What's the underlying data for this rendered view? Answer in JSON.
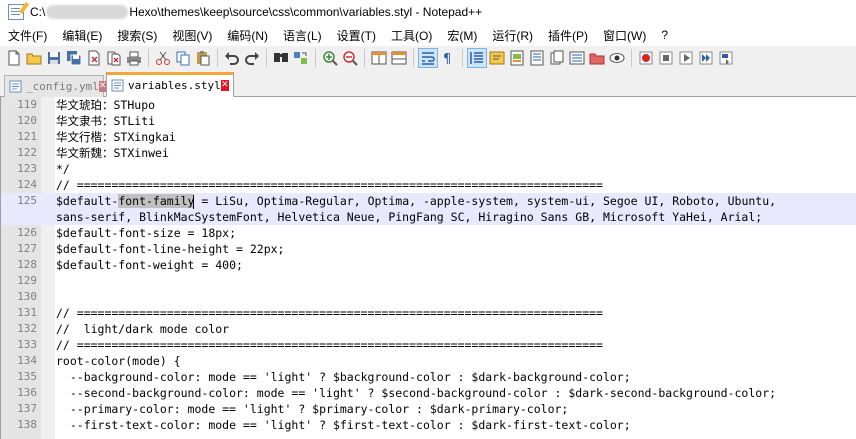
{
  "window": {
    "title_prefix": "C:\\",
    "title_suffix": "Hexo\\themes\\keep\\source\\css\\common\\variables.styl - Notepad++"
  },
  "menu": [
    "文件(F)",
    "编辑(E)",
    "搜索(S)",
    "视图(V)",
    "编码(N)",
    "语言(L)",
    "设置(T)",
    "工具(O)",
    "宏(M)",
    "运行(R)",
    "插件(P)",
    "窗口(W)",
    "?"
  ],
  "tabs": [
    {
      "label": "_config.yml",
      "active": false
    },
    {
      "label": "variables.styl",
      "active": true
    }
  ],
  "editor": {
    "lines": [
      {
        "num": "119",
        "text": "华文琥珀：STHupo"
      },
      {
        "num": "120",
        "text": "华文隶书：STLiti"
      },
      {
        "num": "121",
        "text": "华文行楷：STXingkai"
      },
      {
        "num": "122",
        "text": "华文新魏：STXinwei"
      },
      {
        "num": "123",
        "text": "*/"
      },
      {
        "num": "124",
        "text": "// ============================================================================"
      },
      {
        "num": "125",
        "pre": "$default-",
        "sel": "font-family",
        "post": " = LiSu, Optima-Regular, Optima, -apple-system, system-ui, Segoe UI, Roboto, Ubuntu,"
      },
      {
        "num": "",
        "text": "sans-serif, BlinkMacSystemFont, Helvetica Neue, PingFang SC, Hiragino Sans GB, Microsoft YaHei, Arial;"
      },
      {
        "num": "126",
        "text": "$default-font-size = 18px;"
      },
      {
        "num": "127",
        "text": "$default-font-line-height = 22px;"
      },
      {
        "num": "128",
        "text": "$default-font-weight = 400;"
      },
      {
        "num": "129",
        "text": ""
      },
      {
        "num": "130",
        "text": ""
      },
      {
        "num": "131",
        "text": "// ============================================================================"
      },
      {
        "num": "132",
        "text": "//  light/dark mode color"
      },
      {
        "num": "133",
        "text": "// ============================================================================"
      },
      {
        "num": "134",
        "text": "root-color(mode) {"
      },
      {
        "num": "135",
        "text": "  --background-color: mode == 'light' ? $background-color : $dark-background-color;"
      },
      {
        "num": "136",
        "text": "  --second-background-color: mode == 'light' ? $second-background-color : $dark-second-background-color;"
      },
      {
        "num": "137",
        "text": "  --primary-color: mode == 'light' ? $primary-color : $dark-primary-color;"
      },
      {
        "num": "138",
        "text": "  --first-text-color: mode == 'light' ? $first-text-color : $dark-first-text-color;"
      }
    ]
  }
}
